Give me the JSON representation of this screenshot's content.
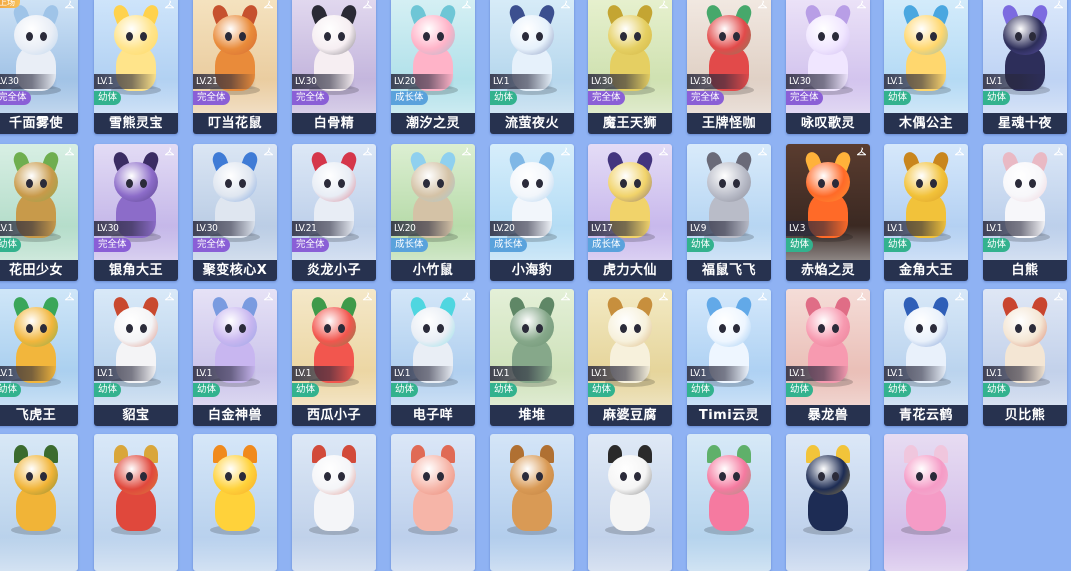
{
  "badge_text": "上场",
  "colors": {
    "background": "#8fb2f3",
    "name_bar": "#27324f",
    "stage_baby": "#33b28e",
    "stage_grow": "#5aa2dc",
    "stage_full": "#8a5fd6"
  },
  "pets": [
    {
      "name": "千面雾使",
      "level": "LV.30",
      "stage": "完全体",
      "badge": true,
      "icon": "hanger-icon",
      "bg": [
        "#cfe3f6",
        "#8fb6e0"
      ],
      "main": "#e9eef6",
      "accent": "#9fc4e8"
    },
    {
      "name": "雪熊灵宝",
      "level": "LV.1",
      "stage": "幼体",
      "icon": "hanger-icon",
      "bg": [
        "#cfe5fb",
        "#a6c9ef"
      ],
      "main": "#ffe48a",
      "accent": "#ffd24d"
    },
    {
      "name": "叮当花鼠",
      "level": "LV.21",
      "stage": "完全体",
      "icon": "hanger-icon",
      "bg": [
        "#f5e3c0",
        "#e6c493"
      ],
      "main": "#e98b3a",
      "accent": "#c6512e"
    },
    {
      "name": "白骨精",
      "level": "LV.30",
      "stage": "完全体",
      "icon": "hanger-icon",
      "bg": [
        "#e2d9ef",
        "#b8a8d6"
      ],
      "main": "#f6eef2",
      "accent": "#2a2a35"
    },
    {
      "name": "潮汐之灵",
      "level": "LV.20",
      "stage": "成长体",
      "icon": "hanger-icon",
      "bg": [
        "#d6f0f4",
        "#a3dbe6"
      ],
      "main": "#ffb3c8",
      "accent": "#6ec6d6"
    },
    {
      "name": "流萤夜火",
      "level": "LV.1",
      "stage": "幼体",
      "icon": "hanger-icon",
      "bg": [
        "#d8ecf8",
        "#a9cfe9"
      ],
      "main": "#e6f1fb",
      "accent": "#3c4f8f"
    },
    {
      "name": "魔王天狮",
      "level": "LV.30",
      "stage": "完全体",
      "icon": "hanger-icon",
      "bg": [
        "#e7f1cf",
        "#c6dba5"
      ],
      "main": "#e5cf62",
      "accent": "#c4a532"
    },
    {
      "name": "王牌怪咖",
      "level": "LV.30",
      "stage": "完全体",
      "icon": "hanger-icon",
      "bg": [
        "#f2e9e2",
        "#d9c7ba"
      ],
      "main": "#e24a4a",
      "accent": "#47a86b"
    },
    {
      "name": "咏叹歌灵",
      "level": "LV.30",
      "stage": "完全体",
      "icon": "hanger-icon",
      "bg": [
        "#ece3f8",
        "#c9b8ea"
      ],
      "main": "#f0e6ff",
      "accent": "#b89ee6"
    },
    {
      "name": "木偶公主",
      "level": "LV.1",
      "stage": "幼体",
      "icon": "hanger-icon",
      "bg": [
        "#d4ecfb",
        "#a8d3f2"
      ],
      "main": "#ffd76e",
      "accent": "#4aa7e0"
    },
    {
      "name": "星魂十夜",
      "level": "LV.1",
      "stage": "幼体",
      "icon": "hanger-icon",
      "bg": [
        "#dbe8fb",
        "#b3cbf1"
      ],
      "main": "#2d2e5a",
      "accent": "#7c6be0"
    },
    {
      "name": "花田少女",
      "level": "LV.1",
      "stage": "幼体",
      "icon": "hanger-icon",
      "bg": [
        "#d8efe4",
        "#a7d6c0"
      ],
      "main": "#c89a4a",
      "accent": "#6fae4f"
    },
    {
      "name": "银角大王",
      "level": "LV.30",
      "stage": "完全体",
      "icon": "hanger-icon",
      "bg": [
        "#e3dcf5",
        "#b9a9e4"
      ],
      "main": "#8c6cc9",
      "accent": "#3a2c63"
    },
    {
      "name": "聚变核心X",
      "level": "LV.30",
      "stage": "完全体",
      "icon": "hanger-icon",
      "bg": [
        "#dbe6f4",
        "#aec3df"
      ],
      "main": "#dfe6f0",
      "accent": "#3f7bd6"
    },
    {
      "name": "炎龙小子",
      "level": "LV.21",
      "stage": "完全体",
      "icon": "hanger-icon",
      "bg": [
        "#dde8f6",
        "#b2c7e6"
      ],
      "main": "#e8edf5",
      "accent": "#d5364a"
    },
    {
      "name": "小竹鼠",
      "level": "LV.20",
      "stage": "成长体",
      "icon": "hanger-icon",
      "bg": [
        "#dcefd2",
        "#a9d39a"
      ],
      "main": "#d4c2a6",
      "accent": "#8fd0ef"
    },
    {
      "name": "小海豹",
      "level": "LV.20",
      "stage": "成长体",
      "icon": "hanger-icon",
      "bg": [
        "#d7eefb",
        "#a6d5f2"
      ],
      "main": "#f2f6fb",
      "accent": "#7fb7e6"
    },
    {
      "name": "虎力大仙",
      "level": "LV.17",
      "stage": "成长体",
      "icon": "hanger-icon",
      "bg": [
        "#e4dcf6",
        "#bdaae8"
      ],
      "main": "#f1d36a",
      "accent": "#43357e"
    },
    {
      "name": "福鼠飞飞",
      "level": "LV.9",
      "stage": "幼体",
      "icon": "hanger-icon",
      "bg": [
        "#d9ebfb",
        "#a9cdef"
      ],
      "main": "#b9bcc8",
      "accent": "#6a6a78"
    },
    {
      "name": "赤焰之灵",
      "level": "LV.3",
      "stage": "幼体",
      "icon": "hanger-icon",
      "bg": [
        "#5a3c2f",
        "#2e211d"
      ],
      "main": "#ff6a28",
      "accent": "#ffb23a"
    },
    {
      "name": "金角大王",
      "level": "LV.1",
      "stage": "幼体",
      "icon": "hanger-icon",
      "bg": [
        "#d6e8fb",
        "#a6c7ef"
      ],
      "main": "#f2c23a",
      "accent": "#c9861d"
    },
    {
      "name": "白熊",
      "level": "LV.1",
      "stage": "幼体",
      "icon": "hanger-icon",
      "bg": [
        "#dbe7f7",
        "#b0c6e6"
      ],
      "main": "#f7f7fa",
      "accent": "#e9b9c4"
    },
    {
      "name": "飞虎王",
      "level": "LV.1",
      "stage": "幼体",
      "icon": "hanger-icon",
      "bg": [
        "#cfe6f8",
        "#9cc7ec"
      ],
      "main": "#f2b63c",
      "accent": "#3aa65a"
    },
    {
      "name": "貂宝",
      "level": "LV.1",
      "stage": "幼体",
      "icon": "hanger-icon",
      "bg": [
        "#d9e9f8",
        "#aecbe8"
      ],
      "main": "#f4f4f6",
      "accent": "#c9492f"
    },
    {
      "name": "白金神兽",
      "level": "LV.1",
      "stage": "幼体",
      "icon": "hanger-icon",
      "bg": [
        "#e6e2f6",
        "#c0b8e6"
      ],
      "main": "#c8b6f0",
      "accent": "#7a9be0"
    },
    {
      "name": "西瓜小子",
      "level": "LV.1",
      "stage": "幼体",
      "icon": "hanger-icon",
      "bg": [
        "#f4e8c9",
        "#e9cf94"
      ],
      "main": "#f2564e",
      "accent": "#3f9a4a"
    },
    {
      "name": "电子咩",
      "level": "LV.1",
      "stage": "幼体",
      "icon": "hanger-icon",
      "bg": [
        "#d3e6f8",
        "#a2c6ec"
      ],
      "main": "#e9eef5",
      "accent": "#4fd6e0"
    },
    {
      "name": "堆堆",
      "level": "LV.1",
      "stage": "幼体",
      "icon": "hanger-icon",
      "bg": [
        "#e4f0d8",
        "#c6dcae"
      ],
      "main": "#86a88a",
      "accent": "#5f8766"
    },
    {
      "name": "麻婆豆腐",
      "level": "LV.1",
      "stage": "幼体",
      "icon": "hanger-icon",
      "bg": [
        "#f3eac4",
        "#e0cc8a"
      ],
      "main": "#f7f1dc",
      "accent": "#c78f3d"
    },
    {
      "name": "Timi云灵",
      "level": "LV.1",
      "stage": "幼体",
      "icon": "hanger-icon",
      "bg": [
        "#d4e8fb",
        "#9fc8f0"
      ],
      "main": "#eef6ff",
      "accent": "#62a9e8"
    },
    {
      "name": "暴龙兽",
      "level": "LV.1",
      "stage": "幼体",
      "icon": "hanger-icon",
      "bg": [
        "#f5ddd8",
        "#e5b3aa"
      ],
      "main": "#f79ab0",
      "accent": "#e06d86"
    },
    {
      "name": "青花云鹤",
      "level": "LV.1",
      "stage": "幼体",
      "icon": "hanger-icon",
      "bg": [
        "#d8e8f8",
        "#aecbea"
      ],
      "main": "#e9f1fb",
      "accent": "#2f5fb8"
    },
    {
      "name": "贝比熊",
      "level": "LV.1",
      "stage": "幼体",
      "icon": "hanger-icon",
      "bg": [
        "#dfe7f5",
        "#b7c8e6"
      ],
      "main": "#f4e6d4",
      "accent": "#c9452f"
    },
    {
      "name": "",
      "level": "",
      "stage": "",
      "icon": "",
      "bg": [
        "#d8e8f6",
        "#b0cbe8"
      ],
      "main": "#f1b437",
      "accent": "#3b6b2e"
    },
    {
      "name": "",
      "level": "",
      "stage": "",
      "icon": "",
      "bg": [
        "#d9e8f8",
        "#b4cdea"
      ],
      "main": "#e0483c",
      "accent": "#d9a63a"
    },
    {
      "name": "",
      "level": "",
      "stage": "",
      "icon": "",
      "bg": [
        "#d6e7f8",
        "#afcaea"
      ],
      "main": "#ffd23a",
      "accent": "#f08a1c"
    },
    {
      "name": "",
      "level": "",
      "stage": "",
      "icon": "",
      "bg": [
        "#dde8f6",
        "#b7cae6"
      ],
      "main": "#f4f5f8",
      "accent": "#d24a3a"
    },
    {
      "name": "",
      "level": "",
      "stage": "",
      "icon": "",
      "bg": [
        "#dbe7f7",
        "#b3c8e8"
      ],
      "main": "#f6b5a8",
      "accent": "#e06a55"
    },
    {
      "name": "",
      "level": "",
      "stage": "",
      "icon": "",
      "bg": [
        "#d4e5f7",
        "#a8c6e9"
      ],
      "main": "#d99a55",
      "accent": "#b07032"
    },
    {
      "name": "",
      "level": "",
      "stage": "",
      "icon": "",
      "bg": [
        "#dfe9f6",
        "#b9cbe7"
      ],
      "main": "#f5f5f5",
      "accent": "#2a2a2a"
    },
    {
      "name": "",
      "level": "",
      "stage": "",
      "icon": "",
      "bg": [
        "#d7e9f7",
        "#abcdea"
      ],
      "main": "#f57aa0",
      "accent": "#5fb06a"
    },
    {
      "name": "",
      "level": "",
      "stage": "",
      "icon": "",
      "bg": [
        "#dce8f7",
        "#b4c9e8"
      ],
      "main": "#1d2c54",
      "accent": "#f2c43a"
    },
    {
      "name": "",
      "level": "",
      "stage": "",
      "icon": "",
      "bg": [
        "#e7dcf2",
        "#cbb3e6"
      ],
      "main": "#f59bc6",
      "accent": "#f0c6dd"
    }
  ]
}
